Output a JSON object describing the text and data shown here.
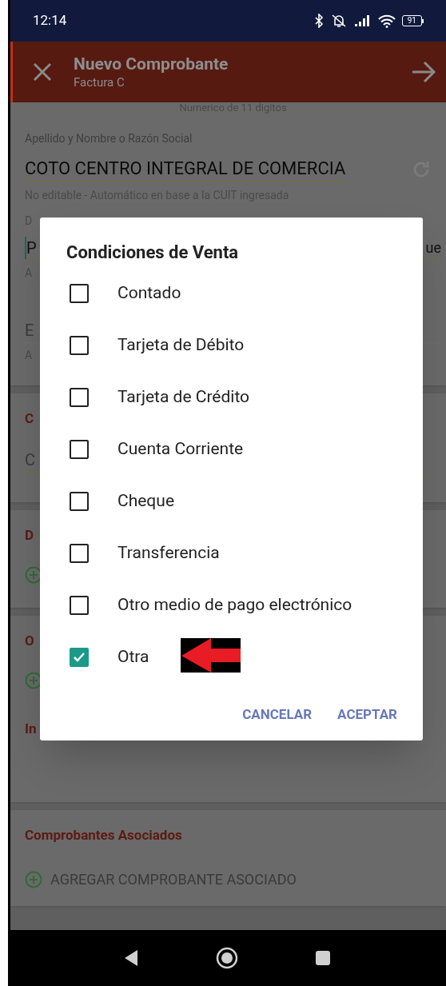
{
  "status_bar": {
    "time": "12:14",
    "battery": "91"
  },
  "header": {
    "title": "Nuevo Comprobante",
    "subtitle": "Factura C"
  },
  "form": {
    "cut_hint": "Numerico de 11 digitos",
    "name_label": "Apellido y Nombre o Razón Social",
    "name_value": "COTO CENTRO INTEGRAL DE COMERCIA",
    "name_hint": "No editable - Automático en base a la CUIT ingresada",
    "fields": [
      {
        "label": "D",
        "value": "P",
        "value_end": "ue",
        "hint": "A",
        "focused": true
      },
      {
        "placeholder": "E",
        "hint": "A",
        "focused": false
      }
    ]
  },
  "sections": [
    {
      "title": "C",
      "kind": "field",
      "value": "C"
    },
    {
      "title": "D",
      "kind": "add"
    },
    {
      "title": "O",
      "kind": "add",
      "extra_title": "In"
    },
    {
      "title": "Comprobantes Asociados",
      "kind": "add",
      "action": "AGREGAR COMPROBANTE ASOCIADO"
    }
  ],
  "dialog": {
    "title": "Condiciones de Venta",
    "options": [
      {
        "label": "Contado",
        "checked": false
      },
      {
        "label": "Tarjeta de Débito",
        "checked": false
      },
      {
        "label": "Tarjeta de Crédito",
        "checked": false
      },
      {
        "label": "Cuenta Corriente",
        "checked": false
      },
      {
        "label": "Cheque",
        "checked": false
      },
      {
        "label": "Transferencia",
        "checked": false
      },
      {
        "label": "Otro medio de pago electrónico",
        "checked": false
      },
      {
        "label": "Otra",
        "checked": true,
        "annotated": true
      }
    ],
    "buttons": [
      "CANCELAR",
      "ACEPTAR"
    ]
  }
}
